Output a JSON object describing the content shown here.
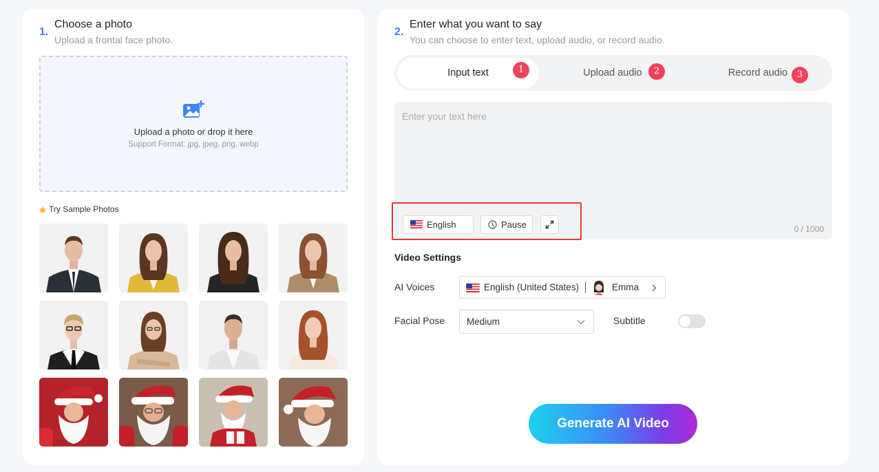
{
  "left": {
    "step_number": "1.",
    "title": "Choose a photo",
    "subtitle": "Upload a frontal face photo.",
    "upload": {
      "icon": "image-add-icon",
      "text": "Upload a photo or drop it here",
      "format": "Support Format: jpg, jpeg, png, webp"
    },
    "sample_label": "Try Sample Photos",
    "sample_icon": "crown-icon",
    "samples": [
      {
        "desc": "man-dark-suit"
      },
      {
        "desc": "woman-yellow-blazer"
      },
      {
        "desc": "woman-black-blazer"
      },
      {
        "desc": "woman-tan-blazer"
      },
      {
        "desc": "woman-glasses-tie"
      },
      {
        "desc": "woman-glasses-beige"
      },
      {
        "desc": "man-white-suit"
      },
      {
        "desc": "woman-red-hair"
      },
      {
        "desc": "santa-1"
      },
      {
        "desc": "santa-2"
      },
      {
        "desc": "santa-3"
      },
      {
        "desc": "santa-4"
      }
    ]
  },
  "right": {
    "step_number": "2.",
    "title": "Enter what you want to say",
    "subtitle": "You can choose to enter text, upload audio, or record audio.",
    "tabs": [
      {
        "label": "Input text",
        "badge": "1"
      },
      {
        "label": "Upload audio",
        "badge": "2"
      },
      {
        "label": "Record audio",
        "badge": "3"
      }
    ],
    "text_placeholder": "Enter your text here",
    "char_count": "0 / 1000",
    "tools": {
      "language": "English",
      "pause": "Pause"
    },
    "video_settings": {
      "title": "Video Settings",
      "ai_voices_label": "AI Voices",
      "voice_language": "English (United States)",
      "voice_name": "Emma",
      "facial_pose_label": "Facial Pose",
      "facial_pose_value": "Medium",
      "subtitle_label": "Subtitle",
      "subtitle_on": false
    },
    "generate_label": "Generate AI Video"
  },
  "colors": {
    "accent": "#4d7cf5",
    "badge": "#f0435a",
    "highlight": "#e53935",
    "gradient": [
      "#1fd1f0",
      "#3a8ef6",
      "#7a3de8",
      "#b02bd6"
    ]
  }
}
